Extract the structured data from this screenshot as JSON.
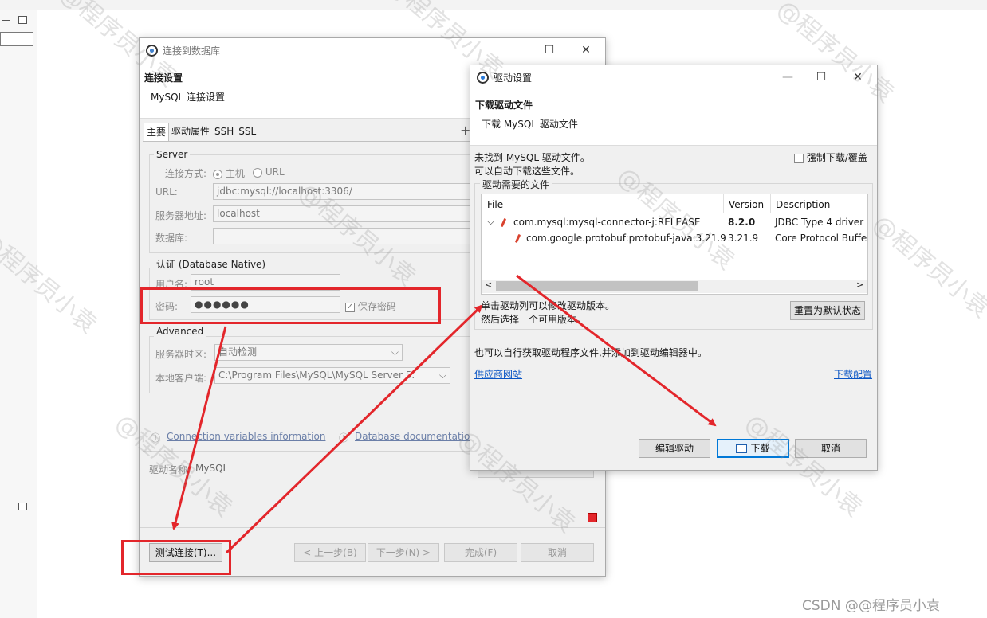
{
  "connect_dialog": {
    "title": "连接到数据库",
    "heading": "连接设置",
    "subheading": "MySQL 连接设置",
    "tabs": [
      "主要",
      "驱动属性",
      "SSH",
      "SSL"
    ],
    "server": {
      "group_title": "Server",
      "connect_mode_label": "连接方式:",
      "mode_host": "主机",
      "mode_url": "URL",
      "url_label": "URL:",
      "url_value": "jdbc:mysql://localhost:3306/",
      "host_label": "服务器地址:",
      "host_value": "localhost",
      "db_label": "数据库:",
      "db_value": ""
    },
    "auth": {
      "group_title": "认证 (Database Native)",
      "user_label": "用户名:",
      "user_value": "root",
      "pwd_label": "密码:",
      "pwd_value": "●●●●●●",
      "save_pwd_label": "保存密码"
    },
    "advanced": {
      "group_title": "Advanced",
      "tz_label": "服务器时区:",
      "tz_value": "自动检测",
      "client_label": "本地客户端:",
      "client_value": "C:\\Program Files\\MySQL\\MySQL Server 5."
    },
    "links": {
      "conn_vars": "Connection variables information",
      "db_docs": "Database documentation"
    },
    "driver_name_label": "驱动名称:",
    "driver_name_value": "MySQL",
    "buttons": {
      "test": "测试连接(T)...",
      "prev": "< 上一步(B)",
      "next": "下一步(N) >",
      "finish": "完成(F)",
      "cancel": "取消"
    }
  },
  "driver_dialog": {
    "title": "驱动设置",
    "heading": "下载驱动文件",
    "subheading": "下载 MySQL 驱动文件",
    "notice_line1": "未找到 MySQL 驱动文件。",
    "notice_line2": "可以自动下载这些文件。",
    "force_download_label": "强制下载/覆盖",
    "files_group_title": "驱动需要的文件",
    "table_headers": {
      "file": "File",
      "version": "Version",
      "description": "Description"
    },
    "rows": [
      {
        "file": "com.mysql:mysql-connector-j:RELEASE",
        "version": "8.2.0",
        "description": "JDBC Type 4 driver"
      },
      {
        "file": "com.google.protobuf:protobuf-java:3.21.9",
        "version": "3.21.9",
        "description": "Core Protocol Buffe"
      }
    ],
    "hint_line1": "单击驱动列可以修改驱动版本。",
    "hint_line2": "然后选择一个可用版本。",
    "reset_button": "重置为默认状态",
    "manual_text": "也可以自行获取驱动程序文件,并添加到驱动编辑器中。",
    "vendor_link": "供应商网站",
    "download_config_link": "下载配置",
    "buttons": {
      "edit": "编辑驱动",
      "download": "下载",
      "cancel": "取消"
    }
  },
  "watermark_text": "@程序员小袁",
  "footer_credit": "CSDN @@程序员小袁",
  "colors": {
    "annotation_red": "#e3262b",
    "link_blue": "#0a55c4",
    "primary_border": "#0078d7"
  }
}
